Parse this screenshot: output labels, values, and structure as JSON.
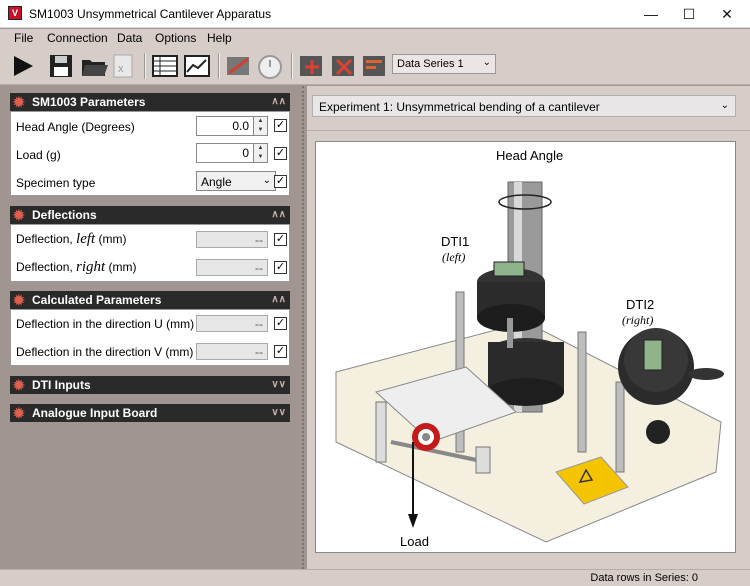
{
  "window": {
    "title": "SM1003 Unsymmetrical Cantilever Apparatus",
    "icon_letter": "V"
  },
  "menu": [
    "File",
    "Connection",
    "Data",
    "Options",
    "Help"
  ],
  "toolbar": {
    "series_value": "Data Series 1"
  },
  "groups": {
    "parameters": {
      "title": "SM1003 Parameters",
      "head_angle_label": "Head Angle  (Degrees)",
      "head_angle_value": "0.0",
      "load_label": "Load  (g)",
      "load_value": "0",
      "specimen_label": "Specimen type",
      "specimen_value": "Angle"
    },
    "deflections": {
      "title": "Deflections",
      "left_prefix": "Deflection, ",
      "left_word": "left",
      "left_unit": "  (mm)",
      "left_value": "--",
      "right_prefix": "Deflection, ",
      "right_word": "right",
      "right_unit": "  (mm)",
      "right_value": "--"
    },
    "calculated": {
      "title": "Calculated Parameters",
      "u_label": "Deflection in the direction U   (mm)",
      "u_value": "--",
      "v_label": "Deflection in the direction V   (mm)",
      "v_value": "--"
    },
    "dti": {
      "title": "DTI Inputs"
    },
    "analogue": {
      "title": "Analogue Input Board"
    }
  },
  "experiment": {
    "selected": "Experiment 1: Unsymmetrical bending of a cantilever"
  },
  "diagram": {
    "head_angle": "Head Angle",
    "dti1": "DTI1",
    "dti1_side": "(left)",
    "dti2": "DTI2",
    "dti2_side": "(right)",
    "load": "Load"
  },
  "status": {
    "rows": "Data rows in Series: 0"
  }
}
